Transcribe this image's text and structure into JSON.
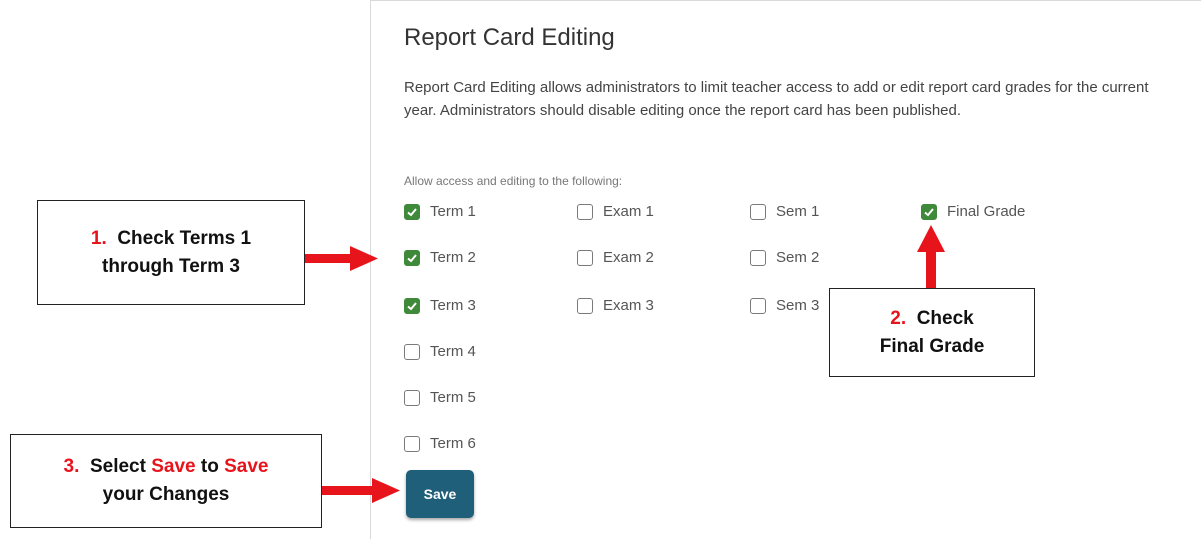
{
  "page": {
    "title": "Report Card Editing",
    "description": "Report Card Editing allows administrators to limit teacher access to add or edit report card grades for the current year. Administrators should disable editing once the report card has been published.",
    "access_label": "Allow access and editing to the following:",
    "checkboxes": {
      "term1": {
        "label": "Term 1",
        "checked": true
      },
      "term2": {
        "label": "Term 2",
        "checked": true
      },
      "term3": {
        "label": "Term 3",
        "checked": true
      },
      "term4": {
        "label": "Term 4",
        "checked": false
      },
      "term5": {
        "label": "Term 5",
        "checked": false
      },
      "term6": {
        "label": "Term 6",
        "checked": false
      },
      "exam1": {
        "label": "Exam 1",
        "checked": false
      },
      "exam2": {
        "label": "Exam 2",
        "checked": false
      },
      "exam3": {
        "label": "Exam 3",
        "checked": false
      },
      "sem1": {
        "label": "Sem 1",
        "checked": false
      },
      "sem2": {
        "label": "Sem 2",
        "checked": false
      },
      "sem3": {
        "label": "Sem 3",
        "checked": false
      },
      "final_grade": {
        "label": "Final Grade",
        "checked": true
      }
    },
    "save_label": "Save"
  },
  "callouts": {
    "step1": {
      "number": "1.",
      "line1": "Check Terms 1",
      "line2": "through Term 3"
    },
    "step2": {
      "number": "2.",
      "line1": "Check",
      "line2": "Final Grade"
    },
    "step3": {
      "number": "3.",
      "select": "Select",
      "save1": "Save",
      "to": "to",
      "save2": "Save",
      "line2": "your Changes"
    }
  },
  "colors": {
    "checked": "#3f8a3a",
    "save_button": "#1f5f7a",
    "annotation_red": "#e8141c"
  }
}
